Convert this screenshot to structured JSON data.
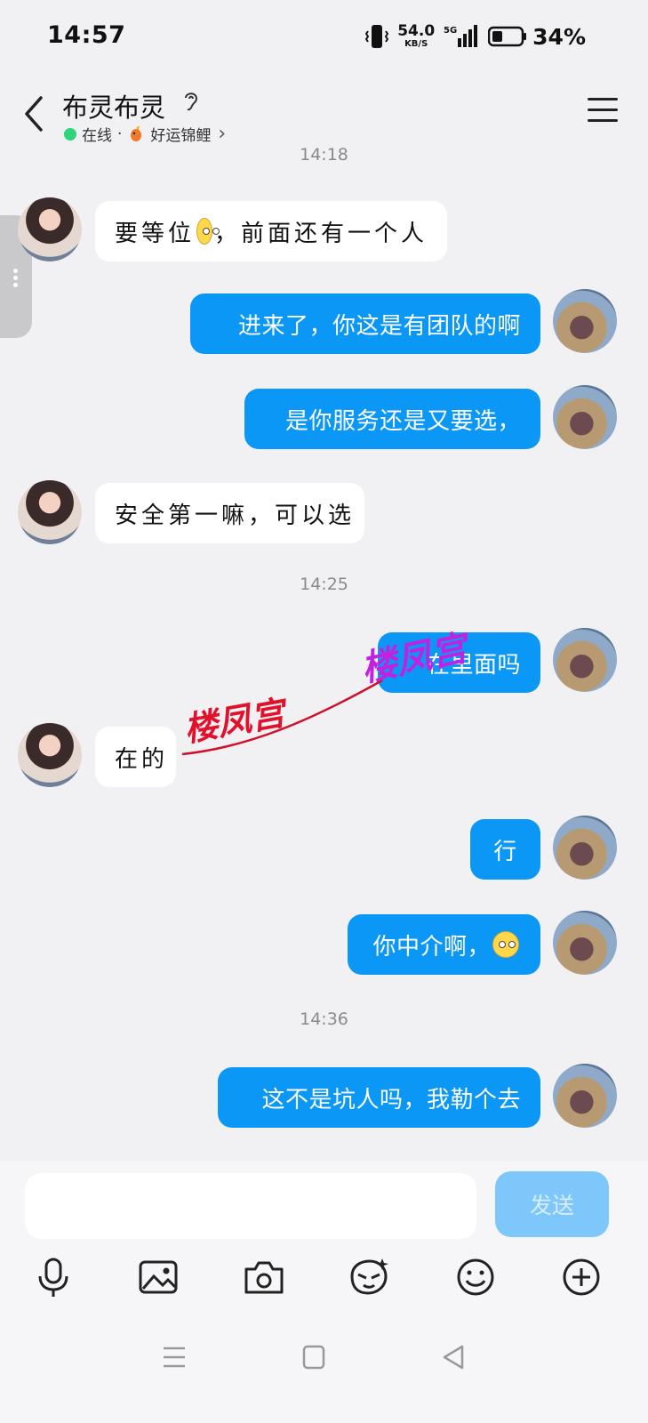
{
  "status_bar": {
    "time": "14:57",
    "net_speed": "54.0",
    "net_unit": "KB/S",
    "signal": "5G",
    "battery_pct": "34%"
  },
  "header": {
    "title": "布灵布灵",
    "status": "在线",
    "separator": "·",
    "tag": "好运锦鲤",
    "tag_chevron": "›"
  },
  "timestamps": [
    "14:18",
    "14:25",
    "14:36"
  ],
  "messages": [
    {
      "side": "in",
      "text_before": "要等位",
      "text_after": "，前面还有一个人"
    },
    {
      "side": "out",
      "text": "进来了，你这是有团队的啊"
    },
    {
      "side": "out",
      "text": "是你服务还是又要选，"
    },
    {
      "side": "in",
      "text": "安全第一嘛，可以选"
    },
    {
      "side": "out",
      "text": "在里面吗"
    },
    {
      "side": "in",
      "text": "在的"
    },
    {
      "side": "out",
      "text": "行"
    },
    {
      "side": "out",
      "text": "你中介啊，"
    },
    {
      "side": "out",
      "text": "这不是坑人吗，我勒个去"
    }
  ],
  "watermarks": [
    "楼凤宫",
    "楼凤宫"
  ],
  "input": {
    "placeholder": "",
    "send_label": "发送"
  },
  "toolbar_icons": [
    "microphone-icon",
    "image-icon",
    "camera-icon",
    "sticker-icon",
    "emoji-icon",
    "plus-icon"
  ],
  "colors": {
    "outgoing_bubble": "#0a97f5",
    "incoming_bubble": "#ffffff",
    "background": "#f1f1f4",
    "online": "#2fd47b",
    "send_disabled": "#7ec7fb"
  }
}
